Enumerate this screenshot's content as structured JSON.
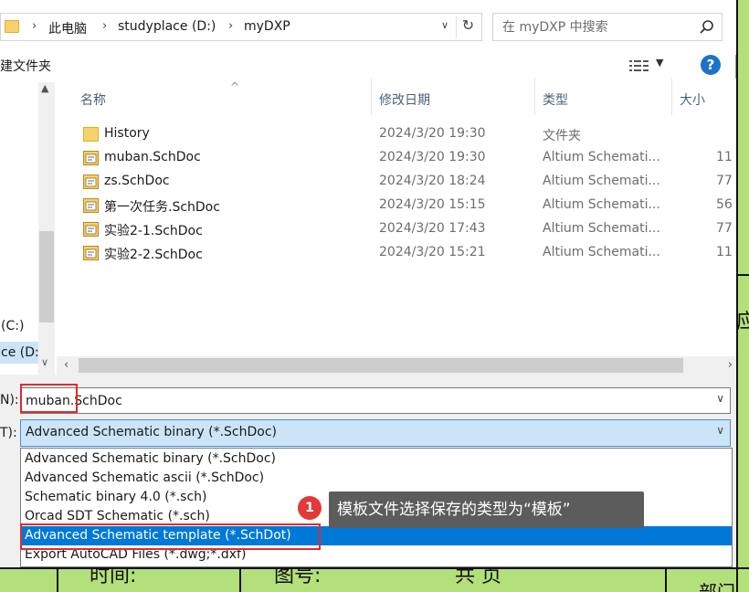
{
  "address": {
    "crumbs": [
      "此电脑",
      "studyplace (D:)",
      "myDXP"
    ]
  },
  "search": {
    "placeholder": "在 myDXP 中搜索"
  },
  "toolbar": {
    "new_folder": "建文件夹",
    "help": "?"
  },
  "nav": {
    "items": [
      {
        "label": "(C:)",
        "selected": false
      },
      {
        "label": "ce (D:)",
        "selected": true
      }
    ]
  },
  "columns": {
    "name": "名称",
    "date": "修改日期",
    "type": "类型",
    "size": "大小"
  },
  "files": [
    {
      "name": "History",
      "date": "2024/3/20 19:30",
      "type": "文件夹",
      "size": "",
      "kind": "folder"
    },
    {
      "name": "muban.SchDoc",
      "date": "2024/3/20 19:30",
      "type": "Altium Schemati...",
      "size": "11",
      "kind": "schdoc"
    },
    {
      "name": "zs.SchDoc",
      "date": "2024/3/20 18:24",
      "type": "Altium Schemati...",
      "size": "77",
      "kind": "schdoc"
    },
    {
      "name": "第一次任务.SchDoc",
      "date": "2024/3/20 15:15",
      "type": "Altium Schemati...",
      "size": "56",
      "kind": "schdoc"
    },
    {
      "name": "实验2-1.SchDoc",
      "date": "2024/3/20 17:43",
      "type": "Altium Schemati...",
      "size": "77",
      "kind": "schdoc"
    },
    {
      "name": "实验2-2.SchDoc",
      "date": "2024/3/20 15:21",
      "type": "Altium Schemati...",
      "size": "11",
      "kind": "schdoc"
    }
  ],
  "form": {
    "filename_label": "N):",
    "filename_value": "muban.SchDoc",
    "type_label": "T):",
    "type_value": "Advanced Schematic binary (*.SchDoc)"
  },
  "type_options": [
    {
      "label": "Advanced Schematic binary (*.SchDoc)",
      "selected": false
    },
    {
      "label": "Advanced Schematic ascii (*.SchDoc)",
      "selected": false
    },
    {
      "label": "Schematic binary 4.0 (*.sch)",
      "selected": false
    },
    {
      "label": "Orcad SDT Schematic (*.sch)",
      "selected": false
    },
    {
      "label": "Advanced Schematic template (*.SchDot)",
      "selected": true
    },
    {
      "label": "Export AutoCAD Files (*.dwg;*.dxf)",
      "selected": false
    }
  ],
  "annotation": {
    "step": "1",
    "text": "模板文件选择保存的类型为“模板”"
  },
  "background": {
    "right_fragment": "应",
    "bottom_texts": [
      "时间:",
      "图号:",
      "共 页",
      "部门"
    ]
  },
  "colors": {
    "accent": "#0078d7",
    "highlight": "#e02b2b",
    "background_sheet": "#b3e07a"
  }
}
